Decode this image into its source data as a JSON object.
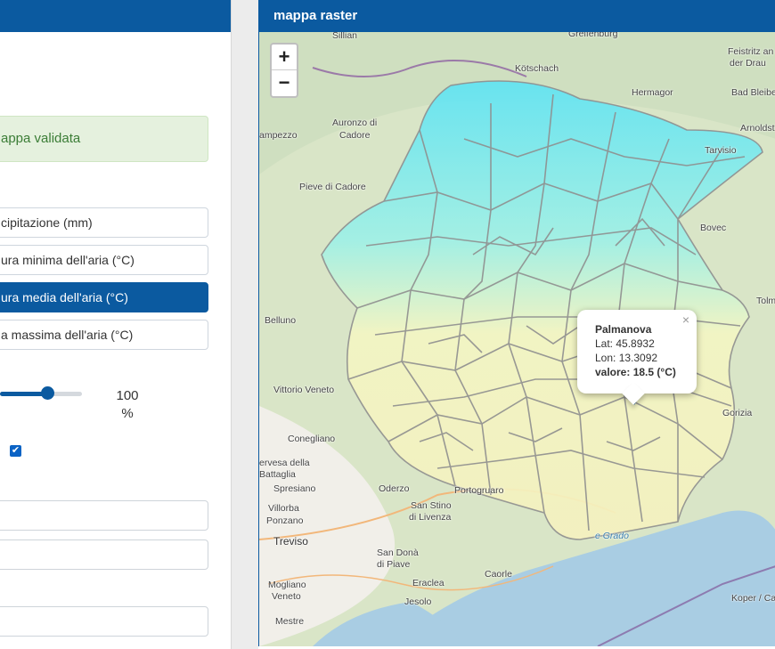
{
  "left_panel": {
    "validated_message": "appa validata",
    "variables": [
      {
        "label": "cipitazione (mm)",
        "active": false
      },
      {
        "label": "ura minima dell'aria (°C)",
        "active": false
      },
      {
        "label": "ura media dell'aria (°C)",
        "active": true
      },
      {
        "label": "a massima dell'aria (°C)",
        "active": false
      }
    ],
    "opacity": {
      "value": 1.0,
      "value_label": "100",
      "unit": "%"
    },
    "checkbox_checked": true,
    "check_mark": "✔",
    "fields": [
      "",
      "",
      ""
    ]
  },
  "map": {
    "title": "mappa raster",
    "zoom_in_label": "+",
    "zoom_out_label": "−",
    "popup": {
      "name": "Palmanova",
      "lat_label": "Lat:",
      "lat": "45.8932",
      "lon_label": "Lon:",
      "lon": "13.3092",
      "value_label": "valore:",
      "value": "18.5 (°C)",
      "close": "×"
    },
    "places": {
      "sillian": "Sillian",
      "greifenburg": "Greifenburg",
      "feistritz": "Feistritz an",
      "der_drau": "der Drau",
      "kotschach": "Kötschach",
      "hermagor": "Hermagor",
      "bad_bleiberg": "Bad Bleibe",
      "auronzo": "Auronzo di",
      "cadore": "Cadore",
      "ampezzo": "ampezzo",
      "arnoldst": "Arnoldst",
      "tarvisio": "Tarvisio",
      "pieve": "Pieve di Cadore",
      "bovec": "Bovec",
      "tolm": "Tolm",
      "belluno": "Belluno",
      "vittorio": "Vittorio Veneto",
      "conegliano": "Conegliano",
      "nervesa": "ervesa della",
      "battaglia": "Battaglia",
      "spresiano": "Spresiano",
      "oderzo": "Oderzo",
      "portogruaro": "Portogruaro",
      "villorba": "Villorba",
      "ponzano": "Ponzano",
      "san_stino": "San Stino",
      "di_livenza": "di Livenza",
      "treviso": "Treviso",
      "san_dona": "San Donà",
      "di_piave": "di Piave",
      "caorle": "Caorle",
      "mogliano": "Mogliano",
      "veneto": "Veneto",
      "eraclea": "Eraclea",
      "jesolo": "Jesolo",
      "mestre": "Mestre",
      "koper": "Koper / Ca",
      "grado": "e Grado",
      "gorizia": "Gorizia"
    }
  },
  "colors": {
    "brand": "#0b5aa0",
    "alert_bg": "#e5f1de",
    "alert_text": "#3b7d36",
    "cold_raster": "#5fe3f3",
    "warm_raster": "#f5f4c0",
    "sea": "#a9cde3",
    "marker": "#2e86c9"
  },
  "icons": {
    "marker": "map-marker-icon"
  }
}
